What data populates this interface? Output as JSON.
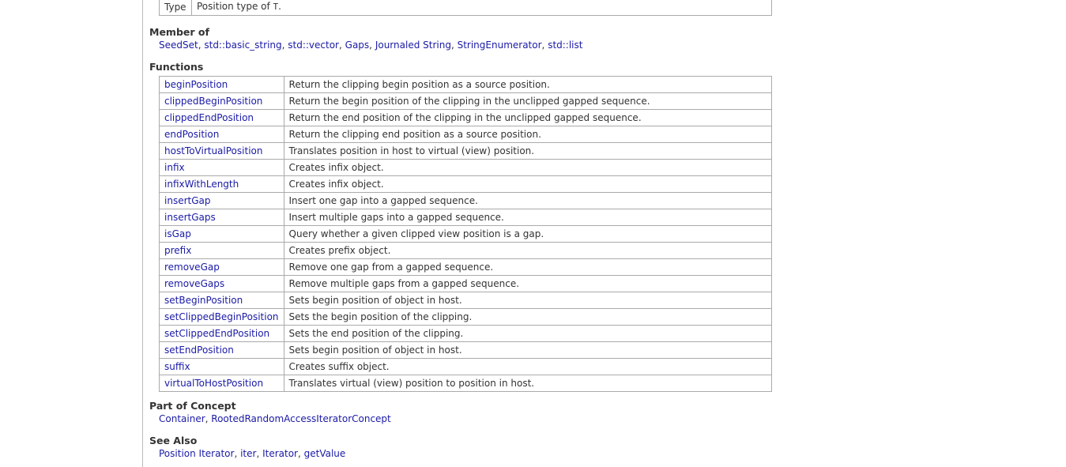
{
  "type_row": {
    "label": "Type",
    "text_prefix": "Position type of ",
    "code": "T",
    "text_suffix": "."
  },
  "member_of": {
    "title": "Member of",
    "items": [
      "SeedSet",
      "std::basic_string",
      "std::vector",
      "Gaps",
      "Journaled String",
      "StringEnumerator",
      "std::list"
    ]
  },
  "functions": {
    "title": "Functions",
    "rows": [
      {
        "name": "beginPosition",
        "desc": "Return the clipping begin position as a source position."
      },
      {
        "name": "clippedBeginPosition",
        "desc": "Return the begin position of the clipping in the unclipped gapped sequence."
      },
      {
        "name": "clippedEndPosition",
        "desc": "Return the end position of the clipping in the unclipped gapped sequence."
      },
      {
        "name": "endPosition",
        "desc": "Return the clipping end position as a source position."
      },
      {
        "name": "hostToVirtualPosition",
        "desc": "Translates position in host to virtual (view) position."
      },
      {
        "name": "infix",
        "desc": "Creates infix object."
      },
      {
        "name": "infixWithLength",
        "desc": "Creates infix object."
      },
      {
        "name": "insertGap",
        "desc": "Insert one gap into a gapped sequence."
      },
      {
        "name": "insertGaps",
        "desc": "Insert multiple gaps into a gapped sequence."
      },
      {
        "name": "isGap",
        "desc": "Query whether a given clipped view position is a gap."
      },
      {
        "name": "prefix",
        "desc": "Creates prefix object."
      },
      {
        "name": "removeGap",
        "desc": "Remove one gap from a gapped sequence."
      },
      {
        "name": "removeGaps",
        "desc": "Remove multiple gaps from a gapped sequence."
      },
      {
        "name": "setBeginPosition",
        "desc": "Sets begin position of object in host."
      },
      {
        "name": "setClippedBeginPosition",
        "desc": "Sets the begin position of the clipping."
      },
      {
        "name": "setClippedEndPosition",
        "desc": "Sets the end position of the clipping."
      },
      {
        "name": "setEndPosition",
        "desc": "Sets begin position of object in host."
      },
      {
        "name": "suffix",
        "desc": "Creates suffix object."
      },
      {
        "name": "virtualToHostPosition",
        "desc": "Translates virtual (view) position to position in host."
      }
    ]
  },
  "part_of_concept": {
    "title": "Part of Concept",
    "items": [
      "Container",
      "RootedRandomAccessIteratorConcept"
    ]
  },
  "see_also": {
    "title": "See Also",
    "items": [
      "Position Iterator",
      "iter",
      "Iterator",
      "getValue"
    ]
  },
  "colors": {
    "link": "#1a1aa6",
    "border": "#aaaaaa",
    "text": "#333333"
  }
}
